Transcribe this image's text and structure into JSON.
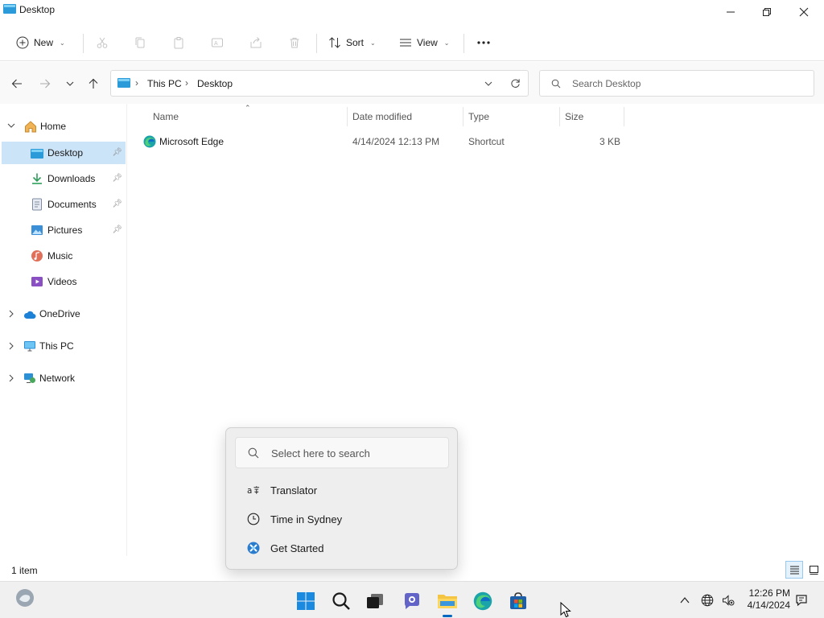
{
  "window": {
    "title": "Desktop",
    "controls": [
      "minimize",
      "restore",
      "close"
    ]
  },
  "toolbar": {
    "new_label": "New",
    "sort_label": "Sort",
    "view_label": "View",
    "icons": [
      "cut-icon",
      "copy-icon",
      "paste-icon",
      "rename-icon",
      "share-icon",
      "delete-icon",
      "more-icon"
    ]
  },
  "address": {
    "crumbs": [
      "This PC",
      "Desktop"
    ]
  },
  "search": {
    "placeholder": "Search Desktop"
  },
  "sidebar": {
    "home": "Home",
    "quick_access": [
      {
        "label": "Desktop",
        "icon": "desktop-icon",
        "pinned": true,
        "selected": true
      },
      {
        "label": "Downloads",
        "icon": "download-icon",
        "pinned": true
      },
      {
        "label": "Documents",
        "icon": "documents-icon",
        "pinned": true
      },
      {
        "label": "Pictures",
        "icon": "pictures-icon",
        "pinned": true
      },
      {
        "label": "Music",
        "icon": "music-icon",
        "pinned": false
      },
      {
        "label": "Videos",
        "icon": "videos-icon",
        "pinned": false
      }
    ],
    "roots": [
      "OneDrive",
      "This PC",
      "Network"
    ]
  },
  "filelist": {
    "columns": [
      "Name",
      "Date modified",
      "Type",
      "Size"
    ],
    "rows": [
      {
        "name": "Microsoft Edge",
        "date": "4/14/2024 12:13 PM",
        "type": "Shortcut",
        "size": "3 KB",
        "icon": "edge-icon"
      }
    ]
  },
  "status": {
    "count": "1 item"
  },
  "popup": {
    "search_placeholder": "Select here to search",
    "items": [
      {
        "label": "Translator",
        "icon": "translator-icon"
      },
      {
        "label": "Time in Sydney",
        "icon": "clock-icon"
      },
      {
        "label": "Get Started",
        "icon": "get-started-icon"
      }
    ]
  },
  "taskbar": {
    "apps": [
      "widgets-icon",
      "start-icon",
      "search-icon",
      "task-view-icon",
      "teams-chat-icon",
      "file-explorer-icon",
      "edge-icon",
      "store-icon"
    ],
    "active_app": "file-explorer-icon",
    "time": "12:26 PM",
    "date": "4/14/2024"
  },
  "colors": {
    "accent": "#0067c0",
    "selection": "#cce4f7",
    "folder": "#f4c542"
  }
}
